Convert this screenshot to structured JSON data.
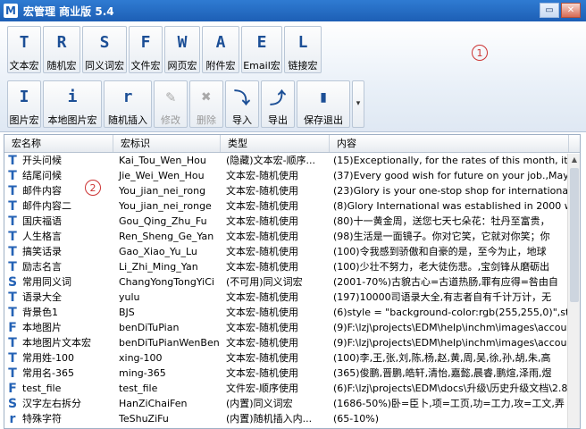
{
  "window": {
    "title": "宏管理 商业版 5.4",
    "app_icon": "M"
  },
  "toolbar": {
    "row1": [
      {
        "glyph": "T",
        "label": "文本宏",
        "disabled": false
      },
      {
        "glyph": "R",
        "label": "随机宏",
        "disabled": false
      },
      {
        "glyph": "S",
        "label": "同义词宏",
        "disabled": false
      },
      {
        "glyph": "F",
        "label": "文件宏",
        "disabled": false
      },
      {
        "glyph": "W",
        "label": "网页宏",
        "disabled": false
      },
      {
        "glyph": "A",
        "label": "附件宏",
        "disabled": false
      },
      {
        "glyph": "E",
        "label": "Email宏",
        "disabled": false
      },
      {
        "glyph": "L",
        "label": "链接宏",
        "disabled": false
      }
    ],
    "row2": [
      {
        "glyph": "I",
        "label": "图片宏",
        "disabled": false
      },
      {
        "glyph": "i",
        "label": "本地图片宏",
        "disabled": false
      },
      {
        "glyph": "r",
        "label": "随机插入",
        "disabled": false
      },
      {
        "glyph": "✎",
        "label": "修改",
        "disabled": true
      },
      {
        "glyph": "✖",
        "label": "删除",
        "disabled": true
      },
      {
        "glyph": "⤵",
        "label": "导入",
        "disabled": false
      },
      {
        "glyph": "⤴",
        "label": "导出",
        "disabled": false
      },
      {
        "glyph": "▮",
        "label": "保存退出",
        "disabled": false
      }
    ]
  },
  "markers": {
    "one": "1",
    "two": "2"
  },
  "grid": {
    "headers": [
      "宏名称",
      "宏标识",
      "类型",
      "内容"
    ],
    "rows": [
      {
        "icon": "T",
        "name": "开头问候",
        "id": "Kai_Tou_Wen_Hou",
        "type": "(隐藏)文本宏-顺序...",
        "content": "(15)Exceptionally, for the rates of this month, it beco"
      },
      {
        "icon": "T",
        "name": "结尾问候",
        "id": "Jie_Wei_Wen_Hou",
        "type": "文本宏-随机使用",
        "content": "(37)Every good wish for future on your job.,May the"
      },
      {
        "icon": "T",
        "name": "邮件内容",
        "id": "You_jian_nei_rong",
        "type": "文本宏-随机使用",
        "content": "(23)Glory is your one-stop shop for international shipp"
      },
      {
        "icon": "T",
        "name": "邮件内容二",
        "id": "You_jian_nei_ronge",
        "type": "文本宏-随机使用",
        "content": "(8)Glory International was established in 2000 with m"
      },
      {
        "icon": "T",
        "name": "国庆福语",
        "id": "Gou_Qing_Zhu_Fu",
        "type": "文本宏-随机使用",
        "content": "(80)十一黄金周，送您七天七朵花：牡丹至富贵，"
      },
      {
        "icon": "T",
        "name": "人生格言",
        "id": "Ren_Sheng_Ge_Yan",
        "type": "文本宏-随机使用",
        "content": "(98)生活是一面镜子。你对它笑，它就对你笑；你"
      },
      {
        "icon": "T",
        "name": "搞笑话录",
        "id": "Gao_Xiao_Yu_Lu",
        "type": "文本宏-随机使用",
        "content": "(100)令我感到骄傲和自豪的是，至今为止，地球"
      },
      {
        "icon": "T",
        "name": "励志名言",
        "id": "Li_Zhi_Ming_Yan",
        "type": "文本宏-随机使用",
        "content": "(100)少壮不努力，老大徒伤悲。,宝剑锋从磨砺出"
      },
      {
        "icon": "S",
        "name": "常用同义词",
        "id": "ChangYongTongYiCi",
        "type": "(不可用)同义词宏",
        "content": "(2001-70%)古貌古心=古道热肠,罪有应得=咎由自"
      },
      {
        "icon": "T",
        "name": "语录大全",
        "id": "yulu",
        "type": "文本宏-随机使用",
        "content": "(197)10000司语录大全,有志者自有千计万计，无"
      },
      {
        "icon": "T",
        "name": "背景色1",
        "id": "BJS",
        "type": "文本宏-随机使用",
        "content": "(6)style = \"background-color:rgb(255,255,0)\",style ="
      },
      {
        "icon": "F",
        "name": "本地图片",
        "id": "benDiTuPian",
        "type": "文本宏-随机使用",
        "content": "(9)F:\\lzj\\projects\\EDM\\help\\inchm\\images\\account.pn"
      },
      {
        "icon": "T",
        "name": "本地图片文本宏",
        "id": "benDiTuPianWenBen",
        "type": "文本宏-随机使用",
        "content": "(9)F:\\lzj\\projects\\EDM\\help\\inchm\\images\\account.pn"
      },
      {
        "icon": "T",
        "name": "常用姓-100",
        "id": "xing-100",
        "type": "文本宏-随机使用",
        "content": "(100)李,王,张,刘,陈,杨,赵,黄,周,吴,徐,孙,胡,朱,高"
      },
      {
        "icon": "T",
        "name": "常用名-365",
        "id": "ming-365",
        "type": "文本宏-随机使用",
        "content": "(365)俊鹏,晋鹏,皓轩,清怡,嘉懿,晨睿,鹏煊,泽雨,煜"
      },
      {
        "icon": "F",
        "name": "test_file",
        "id": "test_file",
        "type": "文件宏-顺序使用",
        "content": "(6)F:\\lzj\\projects\\EDM\\docs\\升级\\历史升级文档\\2.8"
      },
      {
        "icon": "S",
        "name": "汉字左右拆分",
        "id": "HanZiChaiFen",
        "type": "(内置)同义词宏",
        "content": "(1686-50%)卧=臣卜,项=工页,功=工力,攻=工文,弄"
      },
      {
        "icon": "r",
        "name": "特殊字符",
        "id": "TeShuZiFu",
        "type": "(内置)随机插入内...",
        "content": "(65-10%)"
      }
    ]
  },
  "colors": {
    "accent": "#1c4f96",
    "title_bar": "#1d5fb5",
    "marker": "#cc3333"
  }
}
